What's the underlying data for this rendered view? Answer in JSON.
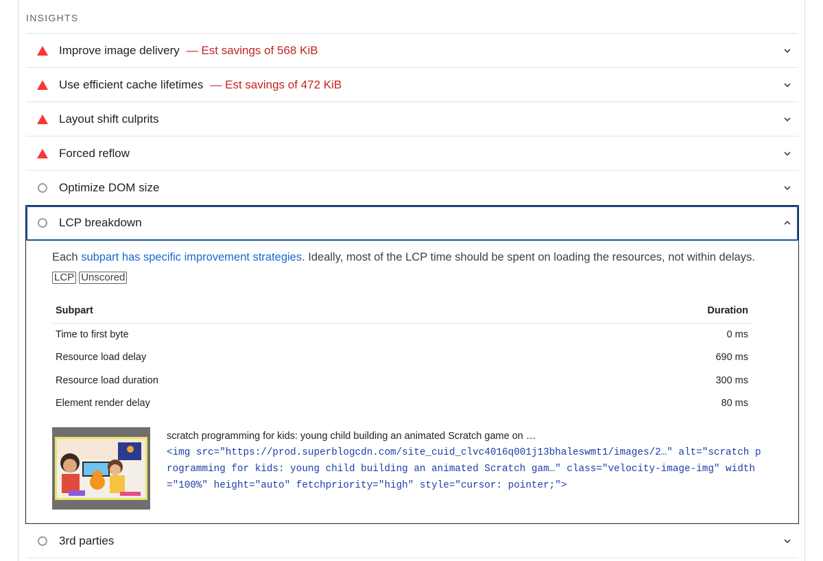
{
  "section": {
    "title": "INSIGHTS"
  },
  "insights": [
    {
      "title": "Improve image delivery",
      "savings": "— Est savings of 568 KiB",
      "status": "fail"
    },
    {
      "title": "Use efficient cache lifetimes",
      "savings": "— Est savings of 472 KiB",
      "status": "fail"
    },
    {
      "title": "Layout shift culprits",
      "savings": "",
      "status": "fail"
    },
    {
      "title": "Forced reflow",
      "savings": "",
      "status": "fail"
    },
    {
      "title": "Optimize DOM size",
      "savings": "",
      "status": "info"
    }
  ],
  "lcp": {
    "title": "LCP breakdown",
    "status": "info",
    "desc_pre": "Each ",
    "desc_link": "subpart has specific improvement strategies",
    "desc_post": ". Ideally, most of the LCP time should be spent on loading the resources, not within delays.",
    "tags": [
      "LCP",
      "Unscored"
    ],
    "table": {
      "headers": {
        "subpart": "Subpart",
        "duration": "Duration"
      },
      "rows": [
        {
          "subpart": "Time to first byte",
          "duration": "0 ms"
        },
        {
          "subpart": "Resource load delay",
          "duration": "690 ms"
        },
        {
          "subpart": "Resource load duration",
          "duration": "300 ms"
        },
        {
          "subpart": "Element render delay",
          "duration": "80 ms"
        }
      ]
    },
    "element": {
      "label": "scratch programming for kids: young child building an animated Scratch game on …",
      "code": "<img src=\"https://prod.superblogcdn.com/site_cuid_clvc4016q001j13bhaleswmt1/images/2…\" alt=\"scratch programming for kids: young child building an animated Scratch gam…\" class=\"velocity-image-img\" width=\"100%\" height=\"auto\" fetchpriority=\"high\" style=\"cursor: pointer;\">"
    }
  },
  "third_parties": {
    "title": "3rd parties",
    "status": "info"
  },
  "colors": {
    "fail": "#ff3333",
    "savings": "#c5221f",
    "link": "#1a67d2",
    "code": "#1a3ea8",
    "focus": "#1a4fa0"
  },
  "icons": {
    "fail": "warning-triangle-icon",
    "info": "info-circle-icon",
    "collapsed": "chevron-down-icon",
    "expanded": "chevron-up-icon"
  }
}
